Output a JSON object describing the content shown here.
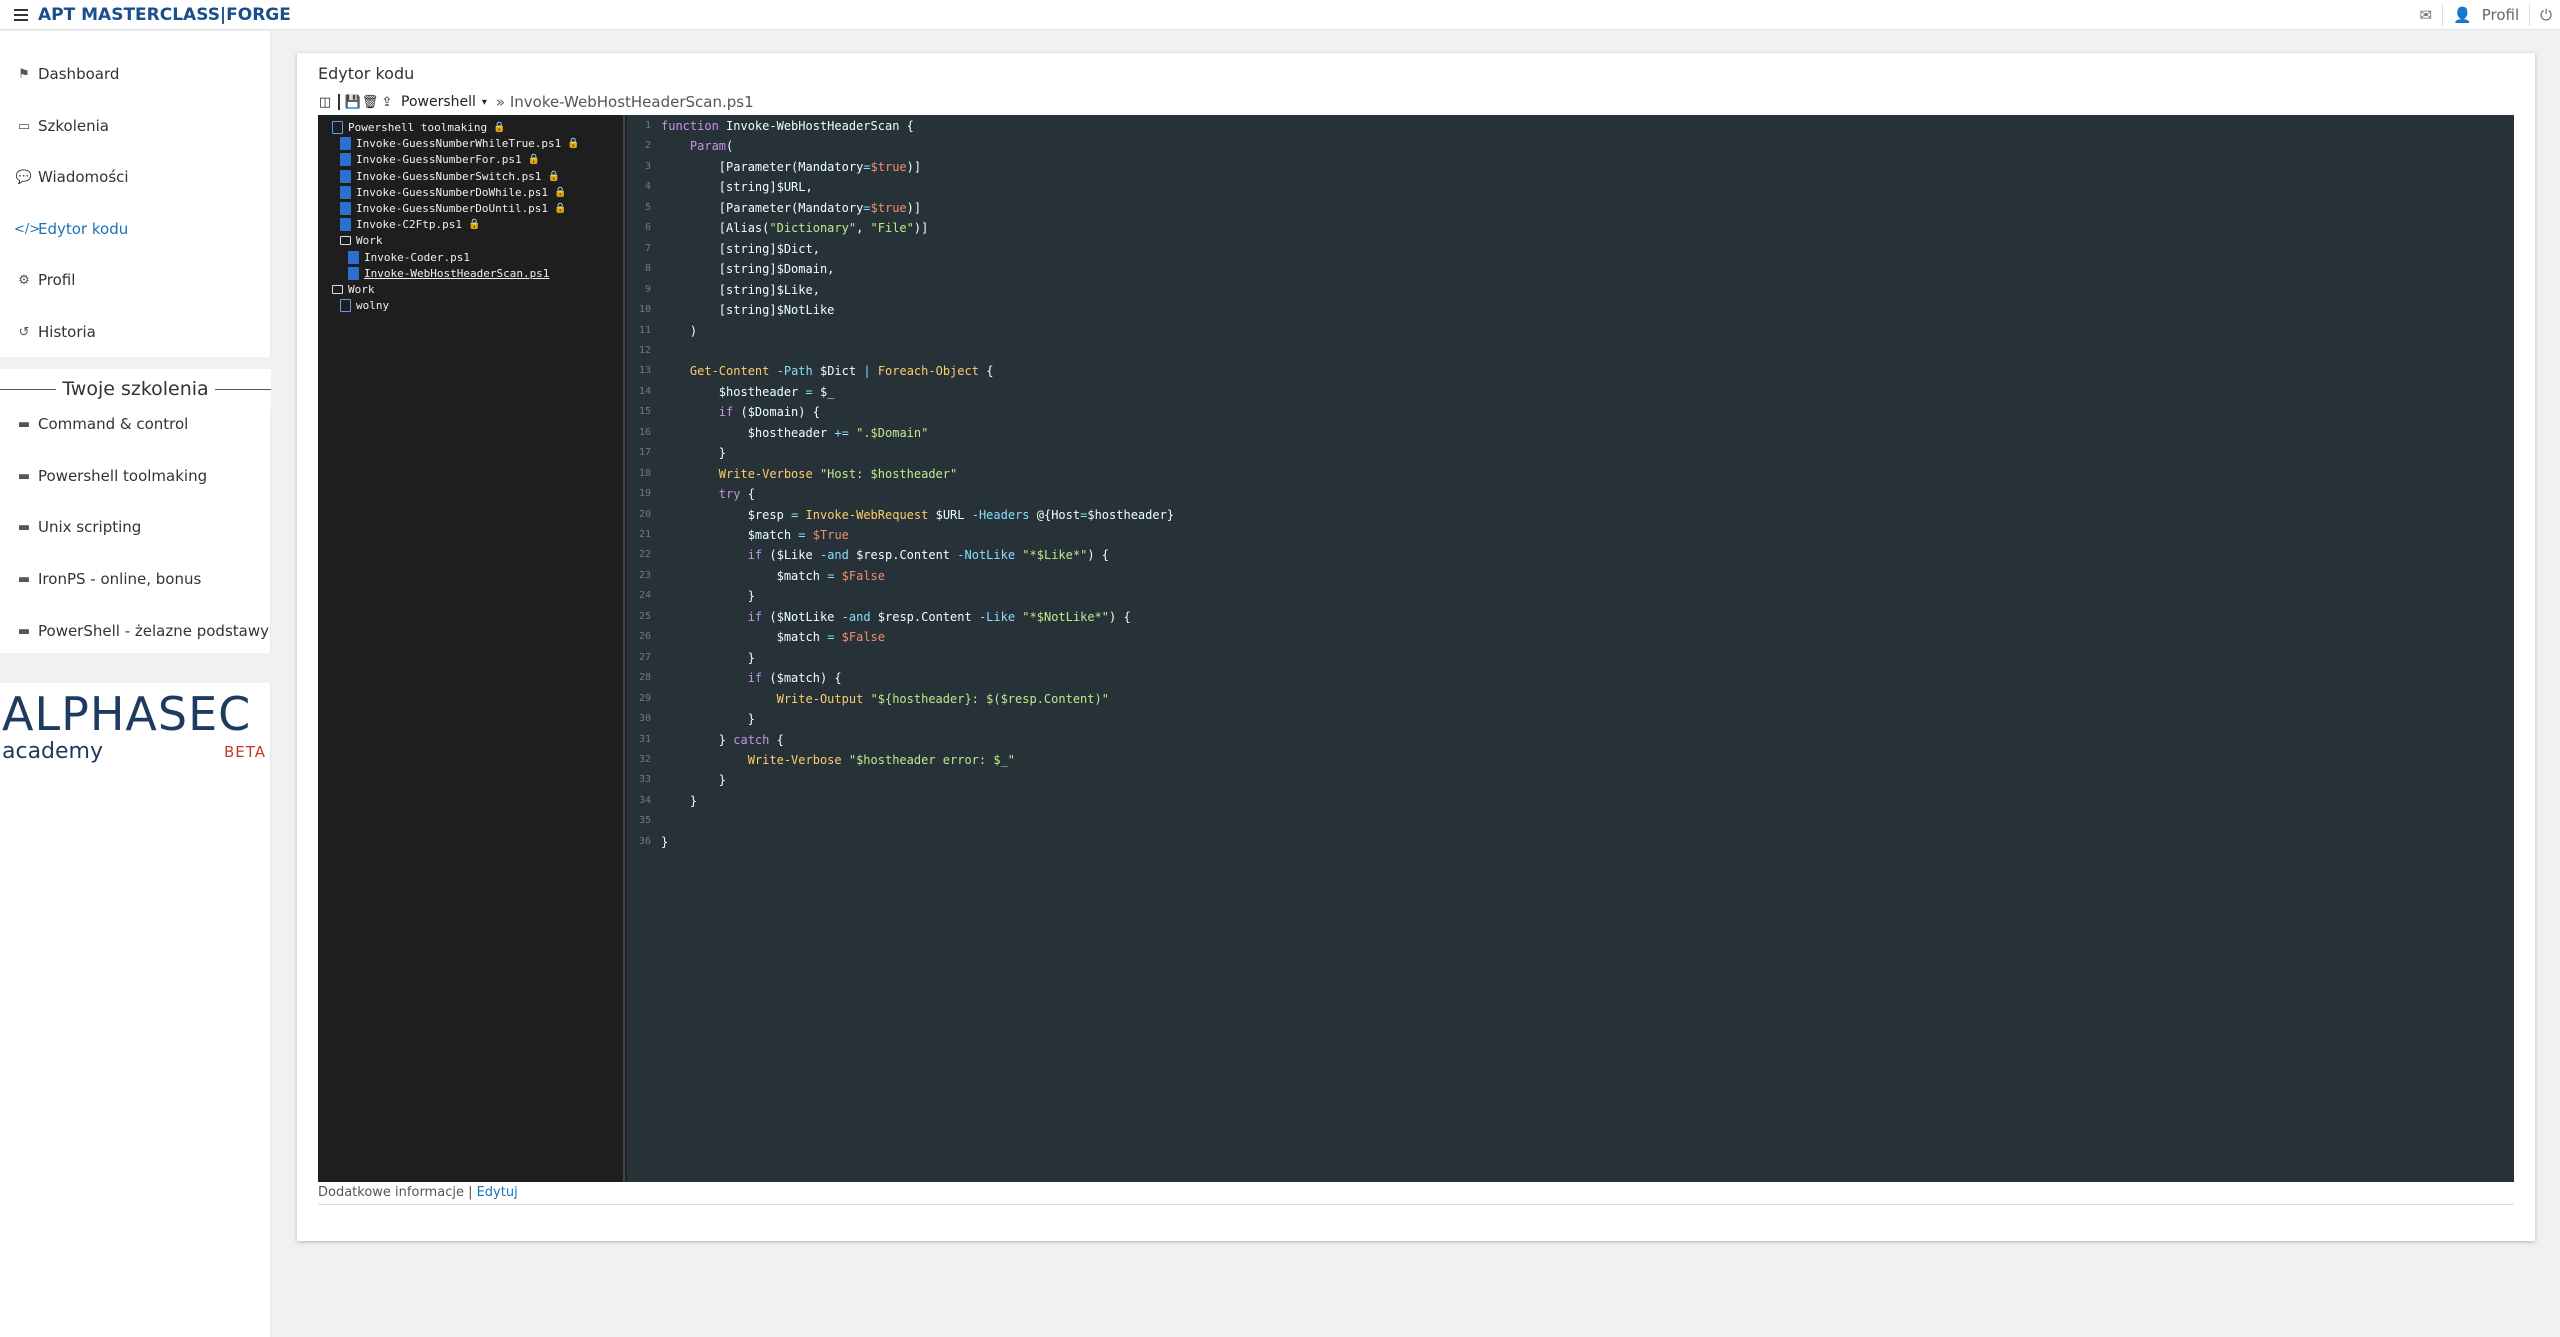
{
  "topbar": {
    "brand": "APT MASTERCLASS|FORGE",
    "profile_label": "Profil",
    "icons": [
      "mail-icon",
      "user-icon",
      "power-icon"
    ]
  },
  "sidebar": {
    "items": [
      {
        "label": "Dashboard",
        "icon": "flag-icon"
      },
      {
        "label": "Szkolenia",
        "icon": "chalkboard-icon"
      },
      {
        "label": "Wiadomości",
        "icon": "comments-icon"
      },
      {
        "label": "Edytor kodu",
        "icon": "code-icon",
        "active": true
      },
      {
        "label": "Profil",
        "icon": "cogs-icon"
      },
      {
        "label": "Historia",
        "icon": "history-icon"
      }
    ],
    "section_title": "Twoje szkolenia",
    "trainings": [
      {
        "label": "Command & control",
        "icon": "book-icon"
      },
      {
        "label": "Powershell toolmaking",
        "icon": "book-icon"
      },
      {
        "label": "Unix scripting",
        "icon": "book-icon"
      },
      {
        "label": "IronPS - online, bonus",
        "icon": "book-icon"
      },
      {
        "label": "PowerShell - żelazne podstawy",
        "icon": "book-icon"
      }
    ],
    "logo": {
      "name": "ALPHASEC",
      "sub": "academy",
      "badge": "BETA"
    }
  },
  "editor": {
    "title": "Edytor kodu",
    "language": "Powershell",
    "path": "» Invoke-WebHostHeaderScan.ps1",
    "tree": [
      {
        "label": "Powershell toolmaking",
        "type": "doc",
        "lock": true,
        "indent": 0
      },
      {
        "label": "Invoke-GuessNumberWhileTrue.ps1",
        "type": "ps",
        "lock": true,
        "indent": 1
      },
      {
        "label": "Invoke-GuessNumberFor.ps1",
        "type": "ps",
        "lock": true,
        "indent": 1
      },
      {
        "label": "Invoke-GuessNumberSwitch.ps1",
        "type": "ps",
        "lock": true,
        "indent": 1
      },
      {
        "label": "Invoke-GuessNumberDoWhile.ps1",
        "type": "ps",
        "lock": true,
        "indent": 1
      },
      {
        "label": "Invoke-GuessNumberDoUntil.ps1",
        "type": "ps",
        "lock": true,
        "indent": 1
      },
      {
        "label": "Invoke-C2Ftp.ps1",
        "type": "ps",
        "lock": true,
        "indent": 1
      },
      {
        "label": "Work",
        "type": "folder",
        "lock": false,
        "indent": 1
      },
      {
        "label": "Invoke-Coder.ps1",
        "type": "ps",
        "lock": false,
        "indent": 2
      },
      {
        "label": "Invoke-WebHostHeaderScan.ps1",
        "type": "ps",
        "lock": false,
        "indent": 2,
        "selected": true
      },
      {
        "label": "Work",
        "type": "folder",
        "lock": false,
        "indent": 0
      },
      {
        "label": "wolny",
        "type": "doc",
        "lock": false,
        "indent": 1
      }
    ],
    "code_lines": [
      "function Invoke-WebHostHeaderScan {",
      "    Param(",
      "        [Parameter(Mandatory=$true)]",
      "        [string]$URL,",
      "        [Parameter(Mandatory=$true)]",
      "        [Alias(\"Dictionary\", \"File\")]",
      "        [string]$Dict,",
      "        [string]$Domain,",
      "        [string]$Like,",
      "        [string]$NotLike",
      "    )",
      "",
      "    Get-Content -Path $Dict | Foreach-Object {",
      "        $hostheader = $_",
      "        if ($Domain) {",
      "            $hostheader += \".$Domain\"",
      "        }",
      "        Write-Verbose \"Host: $hostheader\"",
      "        try {",
      "            $resp = Invoke-WebRequest $URL -Headers @{Host=$hostheader}",
      "            $match = $True",
      "            if ($Like -and $resp.Content -NotLike \"*$Like*\") {",
      "                $match = $False",
      "            }",
      "            if ($NotLike -and $resp.Content -Like \"*$NotLike*\") {",
      "                $match = $False",
      "            }",
      "            if ($match) {",
      "                Write-Output \"${hostheader}: $($resp.Content)\"",
      "            }",
      "        } catch {",
      "            Write-Verbose \"$hostheader error: $_\"",
      "        }",
      "    }",
      "",
      "}"
    ],
    "footer_text": "Dodatkowe informacje | ",
    "footer_link": "Edytuj"
  }
}
